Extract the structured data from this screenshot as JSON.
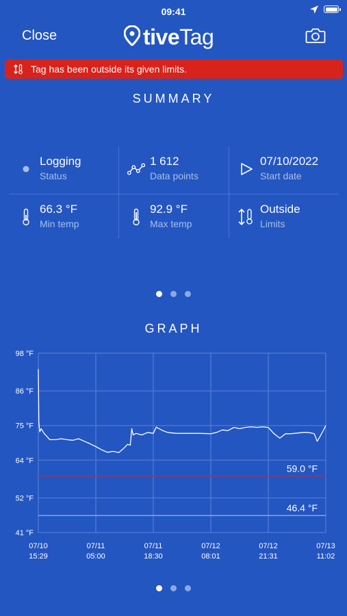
{
  "status_bar": {
    "time": "09:41"
  },
  "nav": {
    "close_label": "Close",
    "logo": {
      "tive": "tive",
      "tag": "Tag"
    }
  },
  "alert": {
    "text": "Tag has been outside its given limits.",
    "color": "#d8231d"
  },
  "summary": {
    "title": "SUMMARY",
    "items": [
      {
        "icon": "status-dot-icon",
        "value": "Logging",
        "label": "Status"
      },
      {
        "icon": "data-points-icon",
        "value": "1 612",
        "label": "Data points"
      },
      {
        "icon": "play-icon",
        "value": "07/10/2022",
        "label": "Start date"
      },
      {
        "icon": "thermometer-icon",
        "value": "66.3 °F",
        "label": "Min temp"
      },
      {
        "icon": "thermometer-icon",
        "value": "92.9 °F",
        "label": "Max temp"
      },
      {
        "icon": "limits-arrows-icon",
        "value": "Outside",
        "label": "Limits"
      }
    ],
    "pager": {
      "count": 3,
      "active": 0
    }
  },
  "graph": {
    "title": "GRAPH",
    "pager": {
      "count": 3,
      "active": 0
    }
  },
  "chart_data": {
    "type": "line",
    "ylim": [
      41,
      98
    ],
    "y_ticks": [
      {
        "value": 98,
        "label": "98 °F"
      },
      {
        "value": 86,
        "label": "86 °F"
      },
      {
        "value": 75,
        "label": "75 °F"
      },
      {
        "value": 64,
        "label": "64 °F"
      },
      {
        "value": 52,
        "label": "52 °F"
      },
      {
        "value": 41,
        "label": "41 °F"
      }
    ],
    "x_range": [
      0,
      1
    ],
    "x_ticks": [
      {
        "date": "07/10",
        "time": "15:29"
      },
      {
        "date": "07/11",
        "time": "05:00"
      },
      {
        "date": "07/11",
        "time": "18:30"
      },
      {
        "date": "07/12",
        "time": "08:01"
      },
      {
        "date": "07/12",
        "time": "21:31"
      },
      {
        "date": "07/13",
        "time": "11:02"
      }
    ],
    "limits": [
      {
        "value": 59.0,
        "label": "59.0 °F",
        "color": "#d8231d"
      },
      {
        "value": 46.4,
        "label": "46.4 °F",
        "color": "#a9bfe8"
      }
    ],
    "series": [
      {
        "color": "#ffffff",
        "x": [
          0,
          0.002,
          0.005,
          0.01,
          0.02,
          0.04,
          0.06,
          0.08,
          0.1,
          0.12,
          0.14,
          0.16,
          0.18,
          0.2,
          0.22,
          0.24,
          0.26,
          0.28,
          0.3,
          0.31,
          0.32,
          0.325,
          0.33,
          0.34,
          0.36,
          0.38,
          0.4,
          0.41,
          0.42,
          0.43,
          0.45,
          0.48,
          0.52,
          0.56,
          0.6,
          0.62,
          0.64,
          0.66,
          0.68,
          0.7,
          0.72,
          0.74,
          0.76,
          0.78,
          0.8,
          0.82,
          0.84,
          0.86,
          0.88,
          0.9,
          0.92,
          0.94,
          0.96,
          0.97,
          0.98,
          0.99,
          1.0
        ],
        "y": [
          92.9,
          76,
          73,
          74,
          72.5,
          70.5,
          70.5,
          70.8,
          70.5,
          70.3,
          70.8,
          70,
          69.2,
          68.3,
          67.3,
          66.5,
          66.8,
          66.4,
          68,
          69,
          68.8,
          74,
          72,
          72.5,
          72,
          72.8,
          72.5,
          74.5,
          74,
          73.5,
          72.8,
          72.5,
          72.5,
          72.5,
          72.4,
          72.8,
          73.6,
          73.4,
          74.4,
          74,
          74.4,
          74.6,
          74.4,
          74.6,
          74.4,
          72.4,
          71,
          72.4,
          72.4,
          72.6,
          72.8,
          72.8,
          72.4,
          70,
          71.5,
          73.2,
          75
        ]
      }
    ],
    "grid": true
  }
}
